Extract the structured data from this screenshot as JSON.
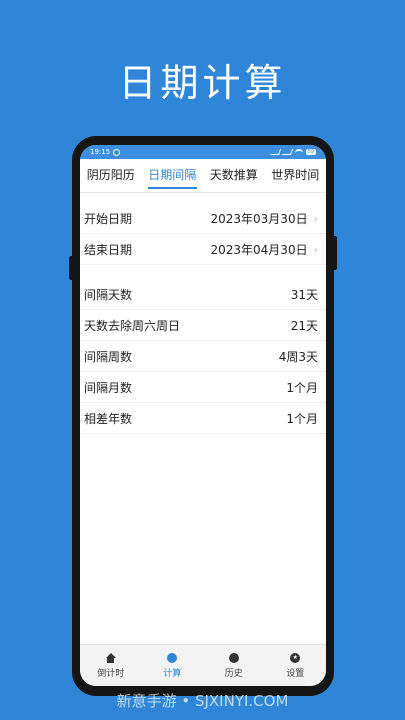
{
  "headline": "日期计算",
  "status_bar": {
    "time": "19:15",
    "battery": "59"
  },
  "tabs": [
    {
      "label": "阴历阳历"
    },
    {
      "label": "日期间隔"
    },
    {
      "label": "天数推算"
    },
    {
      "label": "世界时间"
    }
  ],
  "inputs": {
    "start": {
      "label": "开始日期",
      "value": "2023年03月30日"
    },
    "end": {
      "label": "结束日期",
      "value": "2023年04月30日"
    }
  },
  "results": [
    {
      "label": "间隔天数",
      "value": "31天"
    },
    {
      "label": "天数去除周六周日",
      "value": "21天"
    },
    {
      "label": "间隔周数",
      "value": "4周3天"
    },
    {
      "label": "间隔月数",
      "value": "1个月"
    },
    {
      "label": "相差年数",
      "value": "1个月"
    }
  ],
  "bottom_nav": [
    {
      "label": "倒计时",
      "icon": "home-icon"
    },
    {
      "label": "计算",
      "icon": "compass-icon"
    },
    {
      "label": "历史",
      "icon": "aperture-icon"
    },
    {
      "label": "设置",
      "icon": "star-icon"
    }
  ],
  "watermark": "新意手游 • SJXINYI.COM",
  "colors": {
    "background": "#2f86d8",
    "accent": "#2f86d8"
  }
}
